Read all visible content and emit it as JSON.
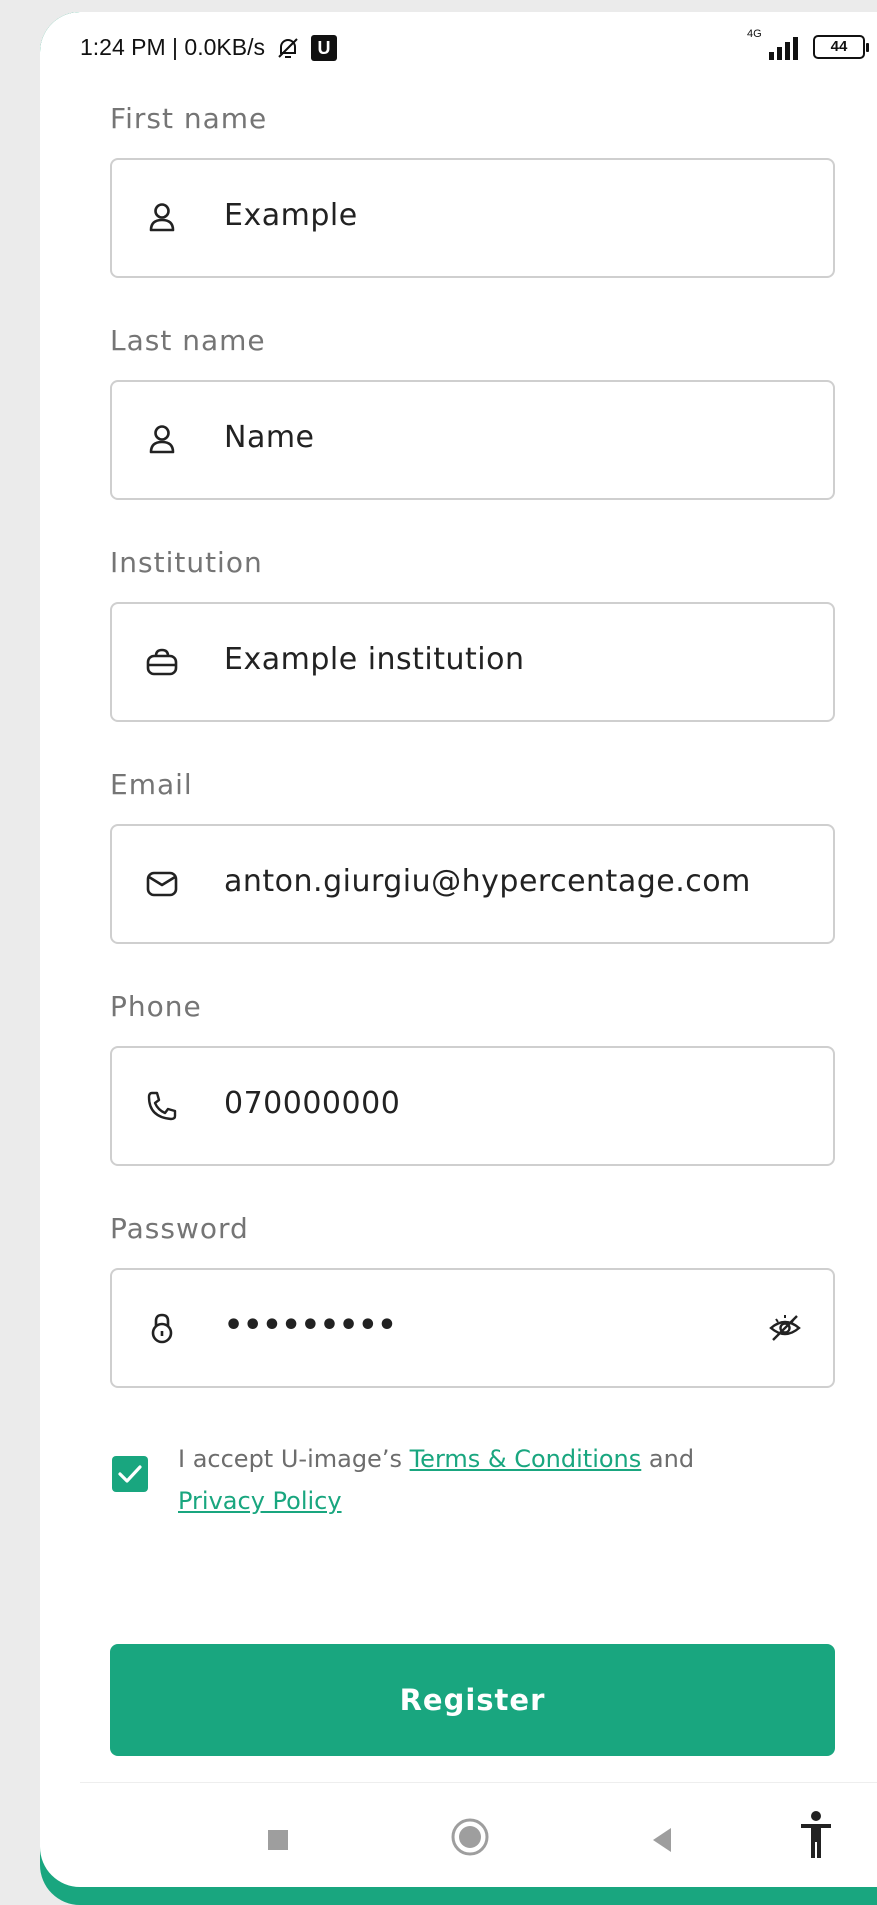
{
  "status_bar": {
    "time_speed": "1:24 PM | 0.0KB/s",
    "badge": "U",
    "network": "4G",
    "battery": "44"
  },
  "form": {
    "first_name": {
      "label": "First name",
      "value": "Example",
      "icon": "person-icon"
    },
    "last_name": {
      "label": "Last name",
      "value": "Name",
      "icon": "person-icon"
    },
    "institution": {
      "label": "Institution",
      "value": "Example institution",
      "icon": "briefcase-icon"
    },
    "email": {
      "label": "Email",
      "value": "anton.giurgiu@hypercentage.com",
      "icon": "envelope-icon"
    },
    "phone": {
      "label": "Phone",
      "value": "070000000",
      "icon": "phone-icon"
    },
    "password": {
      "label": "Password",
      "value": "•••••••••",
      "icon": "lock-icon",
      "toggle_icon": "eye-off-icon"
    }
  },
  "terms": {
    "checked": true,
    "prefix": "I accept U-image’s ",
    "terms_link": "Terms & Conditions",
    "middle": " and",
    "privacy_link": "Privacy Policy"
  },
  "register_label": "Register",
  "colors": {
    "accent": "#19a67f",
    "border": "#cfcfcf",
    "label": "#757575"
  },
  "nav_icons": [
    "recents-icon",
    "home-icon",
    "back-icon",
    "accessibility-icon"
  ]
}
